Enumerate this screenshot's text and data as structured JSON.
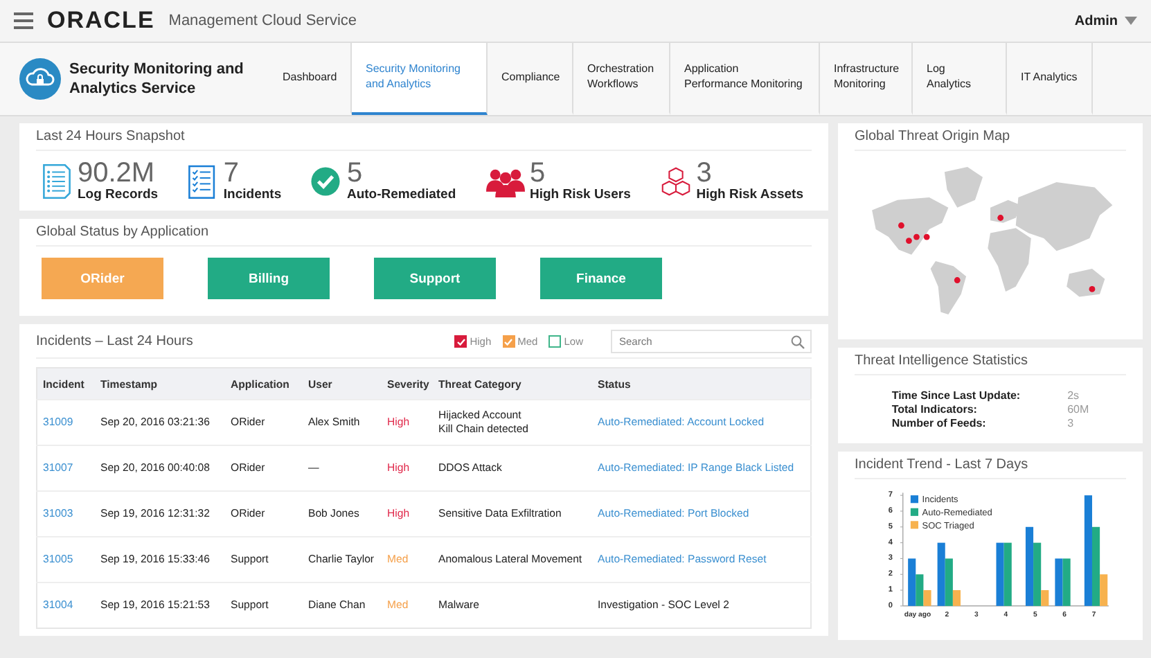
{
  "header": {
    "logo": "ORACLE",
    "product": "Management Cloud Service",
    "user": "Admin"
  },
  "service": {
    "title": "Security Monitoring and Analytics Service"
  },
  "tabs": [
    {
      "label": "Dashboard",
      "selected": false
    },
    {
      "label": "Security Monitoring and Analytics",
      "selected": true
    },
    {
      "label": "Compliance",
      "selected": false
    },
    {
      "label": "Orchestration Workflows",
      "selected": false
    },
    {
      "label": "Application Performance Monitoring",
      "selected": false
    },
    {
      "label": "Infrastructure Monitoring",
      "selected": false
    },
    {
      "label": "Log Analytics",
      "selected": false
    },
    {
      "label": "IT Analytics",
      "selected": false
    }
  ],
  "snapshot": {
    "title": "Last 24 Hours Snapshot",
    "items": [
      {
        "kind": "log",
        "value": "90.2M",
        "label": "Log Records"
      },
      {
        "kind": "checklist",
        "value": "7",
        "label": "Incidents"
      },
      {
        "kind": "check",
        "value": "5",
        "label": "Auto-Remediated"
      },
      {
        "kind": "users",
        "value": "5",
        "label": "High Risk Users"
      },
      {
        "kind": "cubes",
        "value": "3",
        "label": "High Risk Assets"
      }
    ]
  },
  "global_status": {
    "title": "Global Status by Application",
    "apps": [
      {
        "label": "ORider",
        "color": "#f5a852"
      },
      {
        "label": "Billing",
        "color": "#22ab85"
      },
      {
        "label": "Support",
        "color": "#22ab85"
      },
      {
        "label": "Finance",
        "color": "#22ab85"
      }
    ]
  },
  "incidents": {
    "title": "Incidents – Last 24 Hours",
    "filters": [
      {
        "label": "High",
        "checked": true,
        "color": "#d81b3c"
      },
      {
        "label": "Med",
        "checked": true,
        "color": "#f5a04a"
      },
      {
        "label": "Low",
        "checked": false,
        "color": "#3fb58a"
      }
    ],
    "search": {
      "placeholder": "Search"
    },
    "columns": [
      "Incident",
      "Timestamp",
      "Application",
      "User",
      "Severity",
      "Threat Category",
      "Status"
    ],
    "rows": [
      {
        "incident": "31009",
        "timestamp": "Sep 20, 2016 03:21:36",
        "application": "ORider",
        "user": "Alex Smith",
        "severity": "High",
        "color": "#e0284a",
        "threat": [
          "Hijacked Account",
          "Kill Chain detected"
        ],
        "status": "Auto-Remediated: Account Locked",
        "link": true
      },
      {
        "incident": "31007",
        "timestamp": "Sep 20, 2016 00:40:08",
        "application": "ORider",
        "user": "—",
        "severity": "High",
        "color": "#e0284a",
        "threat": [
          "DDOS Attack"
        ],
        "status": "Auto-Remediated: IP Range Black Listed",
        "link": true
      },
      {
        "incident": "31003",
        "timestamp": "Sep 19, 2016 12:31:32",
        "application": "ORider",
        "user": "Bob Jones",
        "severity": "High",
        "color": "#e0284a",
        "threat": [
          "Sensitive Data Exfiltration"
        ],
        "status": "Auto-Remediated: Port Blocked",
        "link": true
      },
      {
        "incident": "31005",
        "timestamp": "Sep 19, 2016 15:33:46",
        "application": "Support",
        "user": "Charlie Taylor",
        "severity": "Med",
        "color": "#f5a04a",
        "threat": [
          "Anomalous Lateral Movement"
        ],
        "status": "Auto-Remediated: Password Reset",
        "link": true
      },
      {
        "incident": "31004",
        "timestamp": "Sep 19, 2016 15:21:53",
        "application": "Support",
        "user": "Diane Chan",
        "severity": "Med",
        "color": "#f5a04a",
        "threat": [
          "Malware"
        ],
        "status": "Investigation - SOC Level 2",
        "link": false
      }
    ]
  },
  "threat_map": {
    "title": "Global Threat Origin Map"
  },
  "threat_stats": {
    "title": "Threat Intelligence Statistics",
    "rows": [
      {
        "label": "Time Since Last Update:",
        "value": "2s"
      },
      {
        "label": "Total Indicators:",
        "value": "60M"
      },
      {
        "label": "Number of Feeds:",
        "value": "3"
      }
    ]
  },
  "trend": {
    "title": "Incident Trend - Last 7 Days",
    "chart_data": {
      "type": "bar",
      "categories": [
        "day ago",
        "2",
        "3",
        "4",
        "5",
        "6",
        "7"
      ],
      "series": [
        {
          "name": "Incidents",
          "color": "#1a7fd6",
          "values": [
            3,
            4,
            0,
            4,
            5,
            3,
            7
          ]
        },
        {
          "name": "Auto-Remediated",
          "color": "#22ab85",
          "values": [
            2,
            3,
            0,
            4,
            4,
            3,
            5
          ]
        },
        {
          "name": "SOC Triaged",
          "color": "#f7b24e",
          "values": [
            1,
            1,
            0,
            0,
            1,
            0,
            2
          ]
        }
      ],
      "ylim": [
        0,
        7
      ],
      "yticks": [
        0,
        1,
        2,
        3,
        4,
        5,
        6,
        7
      ],
      "legend": true
    }
  }
}
